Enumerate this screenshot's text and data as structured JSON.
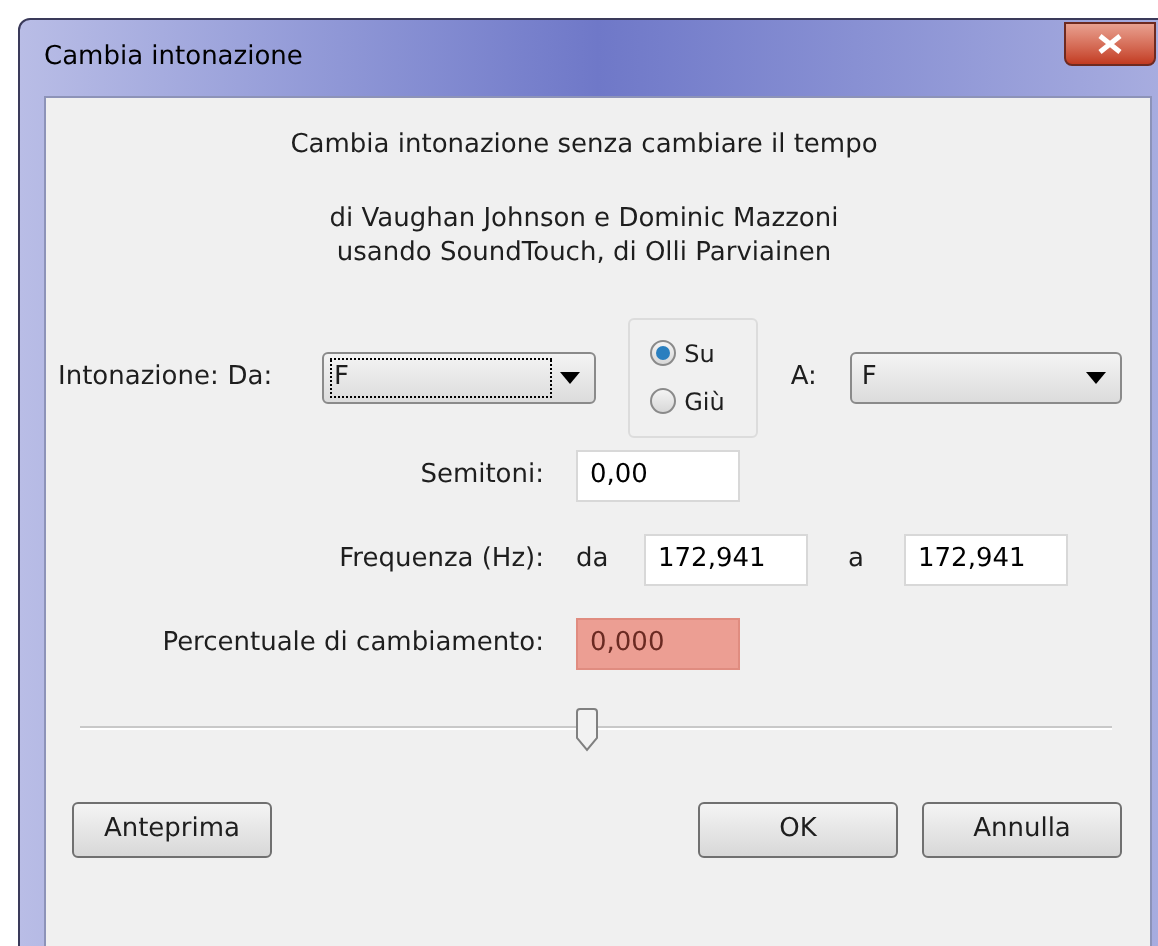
{
  "window": {
    "title": "Cambia intonazione"
  },
  "header": {
    "title": "Cambia intonazione senza cambiare il tempo",
    "credits": [
      "di Vaughan Johnson e Dominic Mazzoni",
      "usando SoundTouch, di Olli Parviainen"
    ]
  },
  "pitch": {
    "label": "Intonazione:",
    "from_label": "Da:",
    "from_value": "F",
    "from_focused": true,
    "direction": [
      {
        "label": "Su",
        "selected": true
      },
      {
        "label": "Giù",
        "selected": false
      }
    ],
    "to_label": "A:",
    "to_value": "F"
  },
  "semitones": {
    "label": "Semitoni:",
    "value": "0,00"
  },
  "frequency": {
    "label": "Frequenza (Hz):",
    "from_label": "da",
    "from_value": "172,941",
    "to_label": "a",
    "to_value": "172,941"
  },
  "percent": {
    "label": "Percentuale di cambiamento:",
    "value": "0,000",
    "invalid": true
  },
  "slider": {
    "level": 0.49
  },
  "buttons": [
    {
      "label": "Anteprima",
      "kind": "left"
    },
    {
      "label": "OK",
      "kind": "right"
    },
    {
      "label": "Annulla",
      "kind": "right"
    }
  ]
}
